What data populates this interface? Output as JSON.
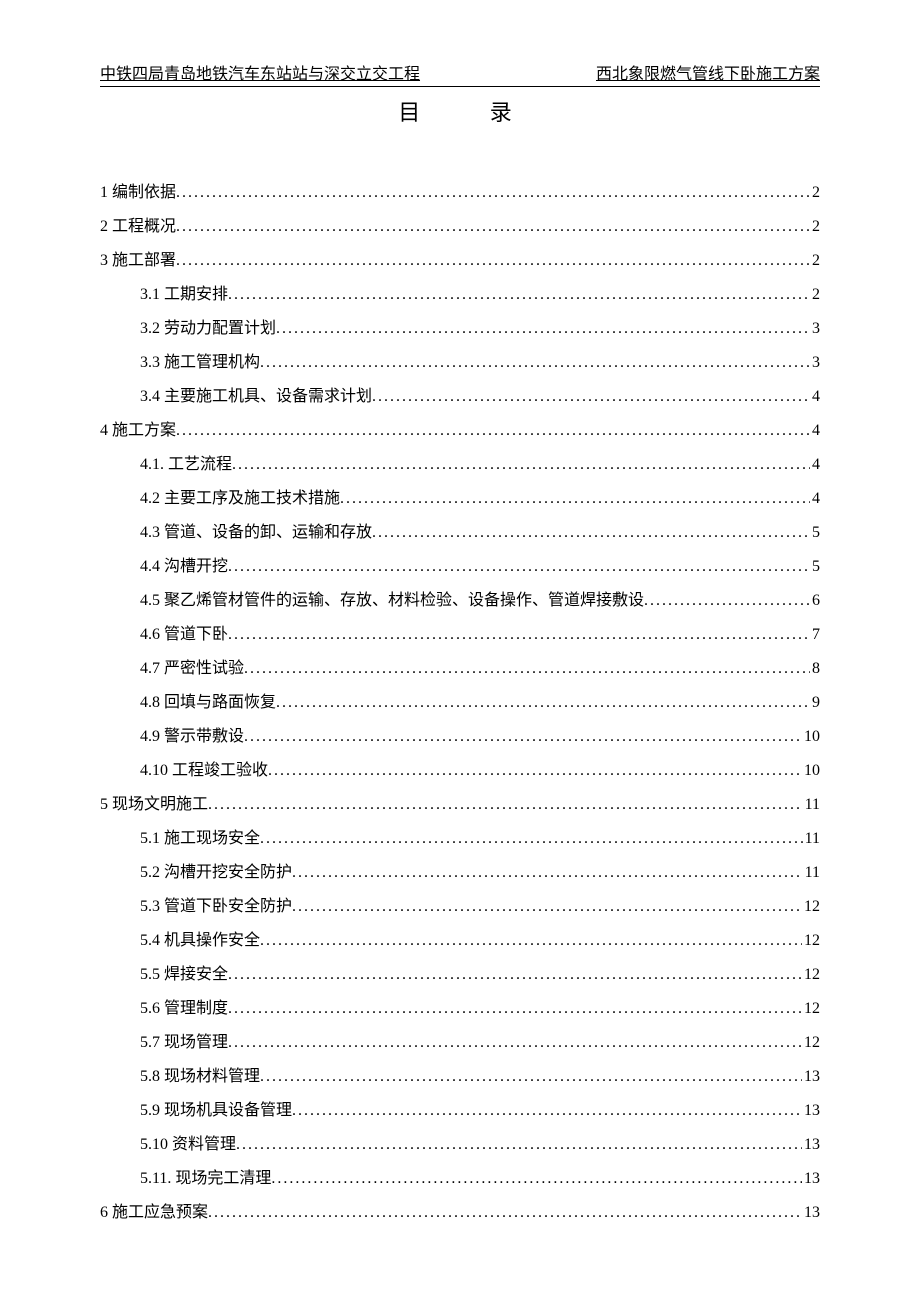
{
  "header": {
    "left": "中铁四局青岛地铁汽车东站站与深交立交工程",
    "right": "西北象限燃气管线下卧施工方案"
  },
  "title": "目 录",
  "toc": [
    {
      "level": 1,
      "text": "1 编制依据",
      "page": "2"
    },
    {
      "level": 1,
      "text": "2 工程概况",
      "page": "2"
    },
    {
      "level": 1,
      "text": "3 施工部署",
      "page": "2"
    },
    {
      "level": 2,
      "text": "3.1 工期安排",
      "page": "2"
    },
    {
      "level": 2,
      "text": "3.2 劳动力配置计划",
      "page": "3"
    },
    {
      "level": 2,
      "text": "3.3 施工管理机构",
      "page": "3"
    },
    {
      "level": 2,
      "text": "3.4 主要施工机具、设备需求计划",
      "page": "4"
    },
    {
      "level": 1,
      "text": "4 施工方案",
      "page": "4"
    },
    {
      "level": 2,
      "text": "4.1. 工艺流程",
      "page": "4"
    },
    {
      "level": 2,
      "text": "4.2 主要工序及施工技术措施",
      "page": "4"
    },
    {
      "level": 2,
      "text": "4.3 管道、设备的卸、运输和存放",
      "page": "5"
    },
    {
      "level": 2,
      "text": "4.4 沟槽开挖",
      "page": "5"
    },
    {
      "level": 2,
      "text": "4.5 聚乙烯管材管件的运输、存放、材料检验、设备操作、管道焊接敷设",
      "page": "6"
    },
    {
      "level": 2,
      "text": "4.6 管道下卧",
      "page": "7"
    },
    {
      "level": 2,
      "text": "4.7 严密性试验",
      "page": "8"
    },
    {
      "level": 2,
      "text": "4.8 回填与路面恢复",
      "page": "9"
    },
    {
      "level": 2,
      "text": "4.9 警示带敷设",
      "page": "10"
    },
    {
      "level": 2,
      "text": "4.10 工程竣工验收",
      "page": "10"
    },
    {
      "level": 1,
      "text": "5 现场文明施工",
      "page": "11"
    },
    {
      "level": 2,
      "text": "5.1 施工现场安全",
      "page": "11"
    },
    {
      "level": 2,
      "text": "5.2 沟槽开挖安全防护",
      "page": "11"
    },
    {
      "level": 2,
      "text": "5.3 管道下卧安全防护",
      "page": "12"
    },
    {
      "level": 2,
      "text": "5.4 机具操作安全",
      "page": "12"
    },
    {
      "level": 2,
      "text": "5.5 焊接安全",
      "page": "12"
    },
    {
      "level": 2,
      "text": "5.6 管理制度",
      "page": "12"
    },
    {
      "level": 2,
      "text": "5.7 现场管理",
      "page": "12"
    },
    {
      "level": 2,
      "text": "5.8 现场材料管理",
      "page": "13"
    },
    {
      "level": 2,
      "text": "5.9 现场机具设备管理",
      "page": "13"
    },
    {
      "level": 2,
      "text": "5.10 资料管理",
      "page": "13"
    },
    {
      "level": 2,
      "text": "5.11. 现场完工清理",
      "page": "13"
    },
    {
      "level": 1,
      "text": "6 施工应急预案",
      "page": "13"
    }
  ]
}
